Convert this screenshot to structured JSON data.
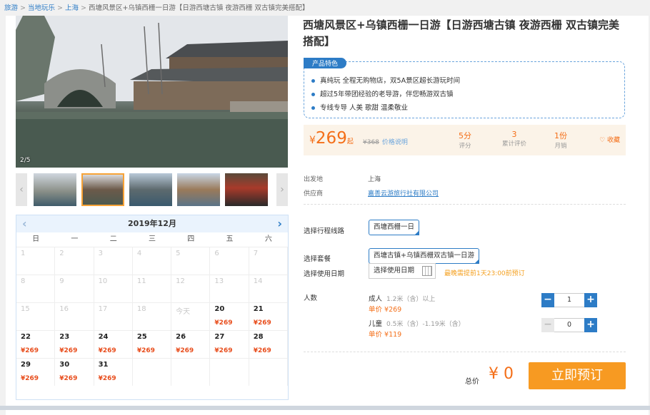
{
  "breadcrumb": {
    "items": [
      "旅游",
      "当地玩乐",
      "上海"
    ],
    "current": "西塘风景区+乌镇西栅一日游【日游西塘古镇 夜游西栅 双古镇完美搭配】",
    "sep": ">"
  },
  "gallery": {
    "pager": "2/5",
    "prev_icon": "‹",
    "next_icon": "›"
  },
  "calendar": {
    "title": "2019年12月",
    "prev_icon": "‹",
    "next_icon": "›",
    "weekdays": [
      "日",
      "一",
      "二",
      "三",
      "四",
      "五",
      "六"
    ],
    "days": [
      {
        "d": "1",
        "p": ""
      },
      {
        "d": "2",
        "p": ""
      },
      {
        "d": "3",
        "p": ""
      },
      {
        "d": "4",
        "p": ""
      },
      {
        "d": "5",
        "p": ""
      },
      {
        "d": "6",
        "p": ""
      },
      {
        "d": "7",
        "p": ""
      },
      {
        "d": "8",
        "p": ""
      },
      {
        "d": "9",
        "p": ""
      },
      {
        "d": "10",
        "p": ""
      },
      {
        "d": "11",
        "p": ""
      },
      {
        "d": "12",
        "p": ""
      },
      {
        "d": "13",
        "p": ""
      },
      {
        "d": "14",
        "p": ""
      },
      {
        "d": "15",
        "p": ""
      },
      {
        "d": "16",
        "p": ""
      },
      {
        "d": "17",
        "p": ""
      },
      {
        "d": "18",
        "p": ""
      },
      {
        "d": "今天",
        "p": ""
      },
      {
        "d": "20",
        "p": "¥269"
      },
      {
        "d": "21",
        "p": "¥269"
      },
      {
        "d": "22",
        "p": "¥269"
      },
      {
        "d": "23",
        "p": "¥269"
      },
      {
        "d": "24",
        "p": "¥269"
      },
      {
        "d": "25",
        "p": "¥269"
      },
      {
        "d": "26",
        "p": "¥269"
      },
      {
        "d": "27",
        "p": "¥269"
      },
      {
        "d": "28",
        "p": "¥269"
      },
      {
        "d": "29",
        "p": "¥269"
      },
      {
        "d": "30",
        "p": "¥269"
      },
      {
        "d": "31",
        "p": "¥269"
      },
      {
        "d": "",
        "p": ""
      },
      {
        "d": "",
        "p": ""
      },
      {
        "d": "",
        "p": ""
      },
      {
        "d": "",
        "p": ""
      }
    ]
  },
  "product": {
    "title": "西塘风景区+乌镇西栅一日游【日游西塘古镇 夜游西栅 双古镇完美搭配】",
    "features_tag": "产品特色",
    "features": [
      "真纯玩 全程无购物店，双5A景区超长游玩时间",
      "超过5年带团经验的老导游，伴您畅游双古镇",
      "专线专导 人美 歌甜 温柔敬业"
    ],
    "price_yen": "¥",
    "price": "269",
    "price_suffix": "起",
    "old_price": "¥368",
    "price_note": "价格说明",
    "stats": [
      {
        "v": "5分",
        "l": "评分"
      },
      {
        "v": "3",
        "l": "累计评价"
      },
      {
        "v": "1份",
        "l": "月销"
      }
    ],
    "fav": "♡ 收藏",
    "origin_label": "出发地",
    "origin": "上海",
    "supplier_label": "供应商",
    "supplier": "嘉善云游旅行社有限公司"
  },
  "booking": {
    "route_label": "选择行程线路",
    "route": "西塘西栅一日",
    "package_label": "选择套餐",
    "package": "西塘古镇+乌镇西栅双古镇一日游",
    "date_label": "选择使用日期",
    "date_placeholder": "选择使用日期",
    "date_note": "最晚需提前1天23:00前预订",
    "people_label": "人数",
    "adult": {
      "label": "成人",
      "desc": "1.2米（含）以上",
      "price": "单价 ¥269",
      "qty": "1"
    },
    "child": {
      "label": "儿童",
      "desc": "0.5米（含）-1.19米（含）",
      "price": "单价 ¥119",
      "qty": "0"
    },
    "minus": "−",
    "plus": "+",
    "total_label": "总价",
    "total": "¥ 0",
    "book_button": "立即预订"
  }
}
